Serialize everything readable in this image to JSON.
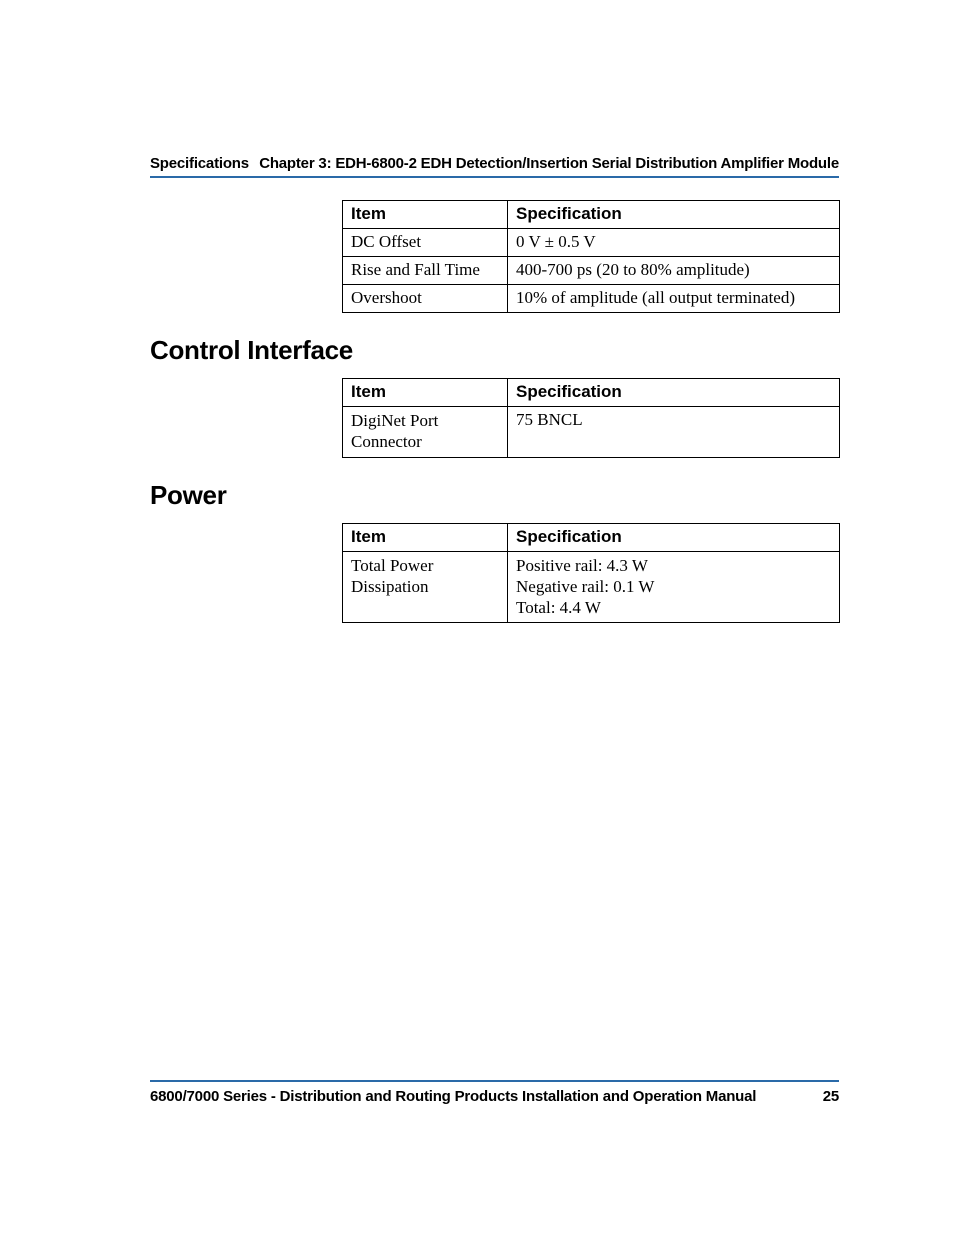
{
  "header": {
    "left": "Specifications",
    "right": "Chapter 3: EDH-6800-2 EDH Detection/Insertion Serial Distribution Amplifier Module"
  },
  "tables": {
    "table1": {
      "head_item": "Item",
      "head_spec": "Specification",
      "rows": [
        {
          "item": "DC Offset",
          "spec": "0 V ± 0.5 V"
        },
        {
          "item": "Rise and Fall Time",
          "spec": "400-700 ps (20 to 80% amplitude)"
        },
        {
          "item": "Overshoot",
          "spec": "10% of amplitude (all output terminated)"
        }
      ]
    },
    "table2": {
      "head_item": "Item",
      "head_spec": "Specification",
      "rows": [
        {
          "item_l1": "DigiNet Port",
          "item_l2": "Connector",
          "spec": "75 BNCL"
        }
      ]
    },
    "table3": {
      "head_item": "Item",
      "head_spec": "Specification",
      "rows": [
        {
          "item_l1": "Total Power",
          "item_l2": "Dissipation",
          "spec_l1": "Positive rail: 4.3 W",
          "spec_l2": "Negative rail: 0.1 W",
          "spec_l3": "Total: 4.4 W"
        }
      ]
    }
  },
  "sections": {
    "control": "Control Interface",
    "power": "Power"
  },
  "footer": {
    "title": "6800/7000 Series - Distribution and Routing Products Installation and Operation Manual",
    "page": "25"
  }
}
